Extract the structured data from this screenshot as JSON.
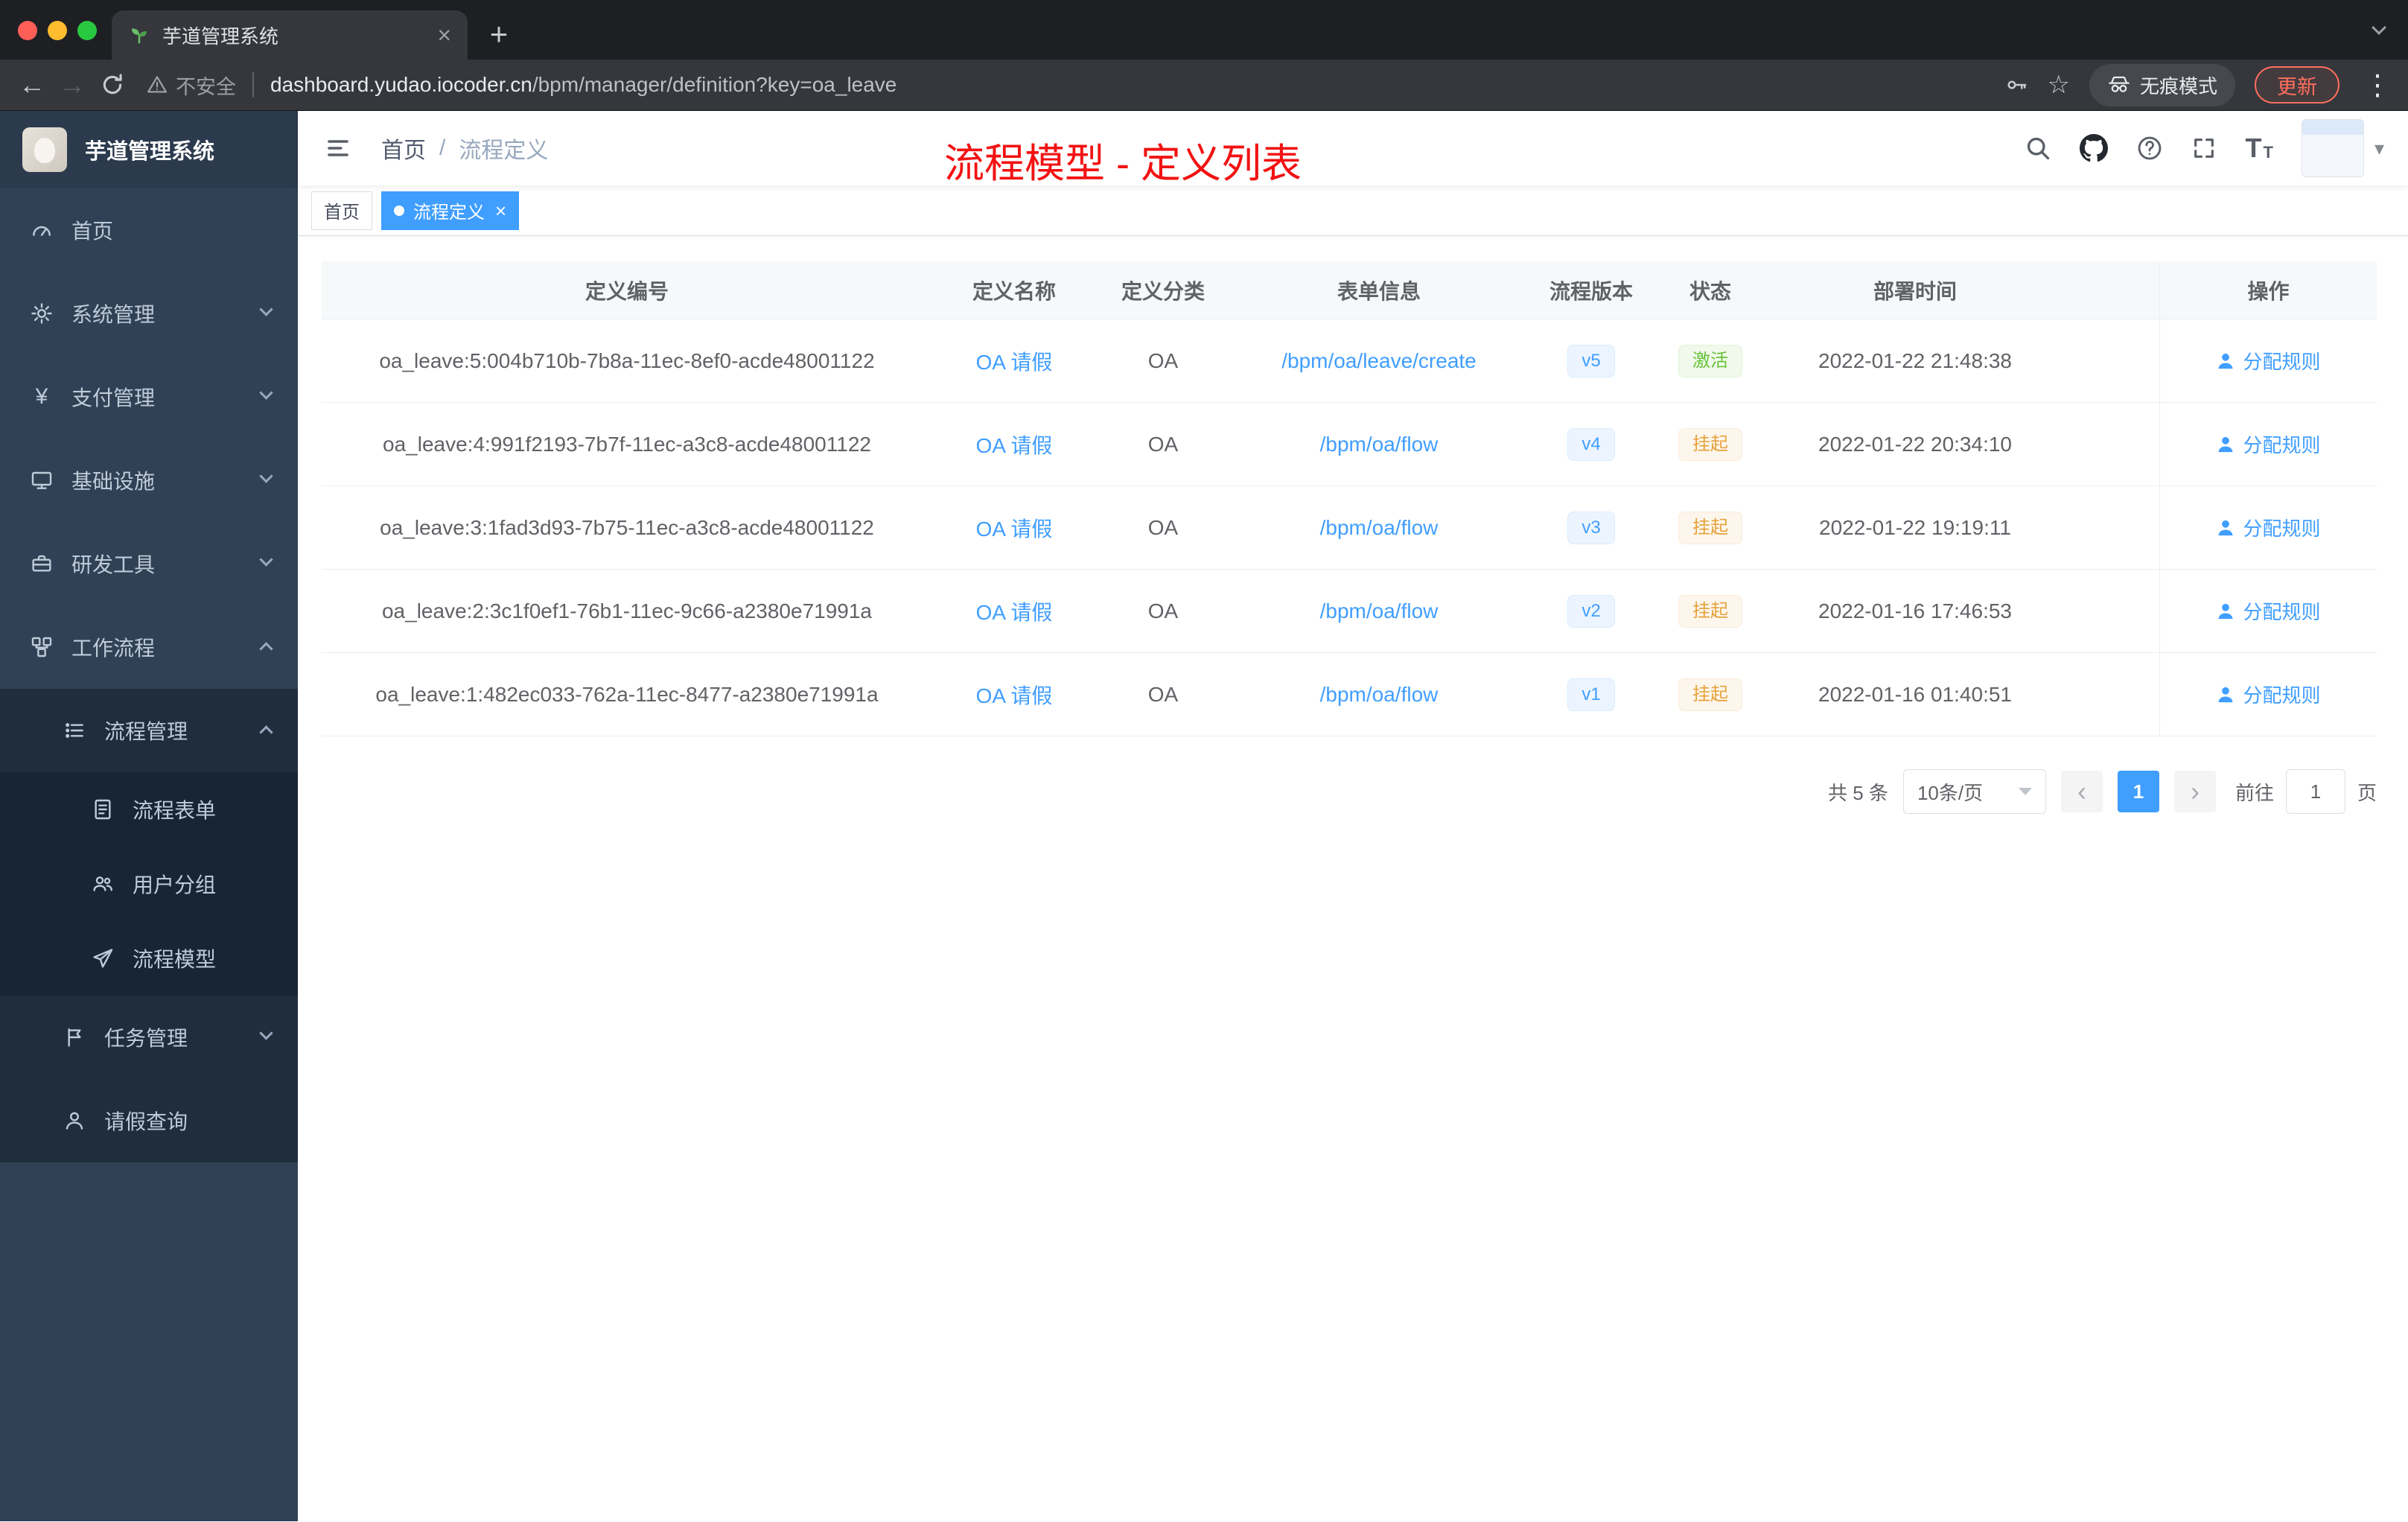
{
  "glyphs": {
    "close": "×",
    "plus": "+",
    "back": "←",
    "forward": "→",
    "kebab": "⋮",
    "star": "☆",
    "prev": "‹",
    "next": "›",
    "slash": "/",
    "caret": "▾",
    "yen": "¥"
  },
  "browser": {
    "tab_title": "芋道管理系统",
    "security_label": "不安全",
    "url_host": "dashboard.yudao.iocoder.cn",
    "url_path": "/bpm/manager/definition?key=oa_leave",
    "incognito_label": "无痕模式",
    "update_label": "更新"
  },
  "sidebar": {
    "logo_title": "芋道管理系统",
    "items": [
      {
        "label": "首页",
        "icon": "dashboard-icon"
      },
      {
        "label": "系统管理",
        "icon": "gear-icon"
      },
      {
        "label": "支付管理",
        "icon": "yen-icon"
      },
      {
        "label": "基础设施",
        "icon": "monitor-icon"
      },
      {
        "label": "研发工具",
        "icon": "toolbox-icon"
      },
      {
        "label": "工作流程",
        "icon": "workflow-icon"
      },
      {
        "label": "流程管理",
        "icon": "list-icon"
      },
      {
        "label": "流程表单",
        "icon": "form-icon"
      },
      {
        "label": "用户分组",
        "icon": "users-icon"
      },
      {
        "label": "流程模型",
        "icon": "paper-plane-icon"
      },
      {
        "label": "任务管理",
        "icon": "flag-icon"
      },
      {
        "label": "请假查询",
        "icon": "user-icon"
      }
    ]
  },
  "navbar": {
    "breadcrumb_home": "首页",
    "breadcrumb_current": "流程定义",
    "annotation": "流程模型 - 定义列表"
  },
  "tags": {
    "items": [
      {
        "label": "首页",
        "active": false
      },
      {
        "label": "流程定义",
        "active": true
      }
    ]
  },
  "table": {
    "columns": {
      "id": "定义编号",
      "name": "定义名称",
      "category": "定义分类",
      "form": "表单信息",
      "version": "流程版本",
      "status": "状态",
      "deploy": "部署时间",
      "action": "操作"
    },
    "rows": [
      {
        "id": "oa_leave:5:004b710b-7b8a-11ec-8ef0-acde48001122",
        "name": "OA 请假",
        "category": "OA",
        "form": "/bpm/oa/leave/create",
        "version": "v5",
        "status": "激活",
        "status_type": "success",
        "deploy": "2022-01-22 21:48:38",
        "action": "分配规则"
      },
      {
        "id": "oa_leave:4:991f2193-7b7f-11ec-a3c8-acde48001122",
        "name": "OA 请假",
        "category": "OA",
        "form": "/bpm/oa/flow",
        "version": "v4",
        "status": "挂起",
        "status_type": "warning",
        "deploy": "2022-01-22 20:34:10",
        "action": "分配规则"
      },
      {
        "id": "oa_leave:3:1fad3d93-7b75-11ec-a3c8-acde48001122",
        "name": "OA 请假",
        "category": "OA",
        "form": "/bpm/oa/flow",
        "version": "v3",
        "status": "挂起",
        "status_type": "warning",
        "deploy": "2022-01-22 19:19:11",
        "action": "分配规则"
      },
      {
        "id": "oa_leave:2:3c1f0ef1-76b1-11ec-9c66-a2380e71991a",
        "name": "OA 请假",
        "category": "OA",
        "form": "/bpm/oa/flow",
        "version": "v2",
        "status": "挂起",
        "status_type": "warning",
        "deploy": "2022-01-16 17:46:53",
        "action": "分配规则"
      },
      {
        "id": "oa_leave:1:482ec033-762a-11ec-8477-a2380e71991a",
        "name": "OA 请假",
        "category": "OA",
        "form": "/bpm/oa/flow",
        "version": "v1",
        "status": "挂起",
        "status_type": "warning",
        "deploy": "2022-01-16 01:40:51",
        "action": "分配规则"
      }
    ]
  },
  "pagination": {
    "total": "共 5 条",
    "page_size": "10条/页",
    "current_page": "1",
    "goto_label": "前往",
    "goto_value": "1",
    "page_unit": "页"
  },
  "colors": {
    "accent": "#409eff",
    "success": "#67c23a",
    "warning": "#e6a23c",
    "annotation_red": "#f21212",
    "sidebar_bg": "#304156",
    "sidebar_submenu_bg": "#1f2d3d"
  }
}
